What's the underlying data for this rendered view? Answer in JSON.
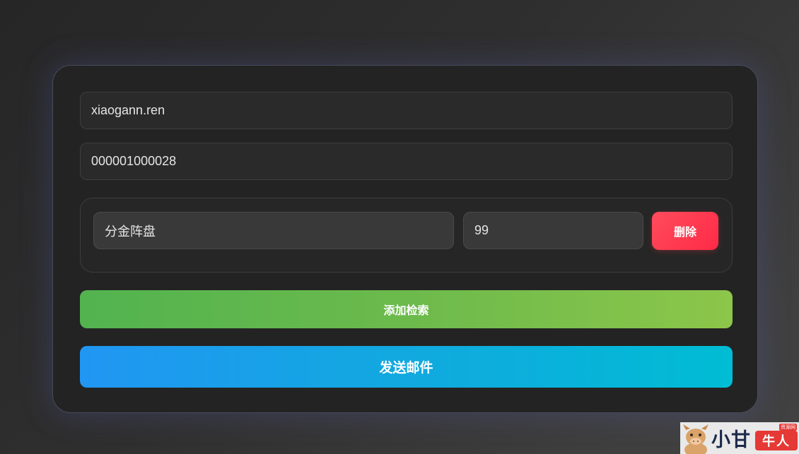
{
  "form": {
    "domain_value": "xiaogann.ren",
    "account_value": "000001000028"
  },
  "items": [
    {
      "name_value": "分金阵盘",
      "quantity_value": "99",
      "delete_label": "删除"
    }
  ],
  "actions": {
    "add_label": "添加检索",
    "send_label": "发送邮件"
  },
  "watermark": {
    "title": "小甘",
    "badge": "牛人",
    "tag": "资源网",
    "mascot_icon": "ox-mascot-icon"
  },
  "colors": {
    "card_background": "#232323",
    "delete_button": "#ff3b52",
    "add_button_start": "#52b34f",
    "add_button_end": "#8cc64a",
    "send_button_start": "#2196f3",
    "send_button_end": "#00bcd4",
    "card_glow": "#5860be"
  }
}
